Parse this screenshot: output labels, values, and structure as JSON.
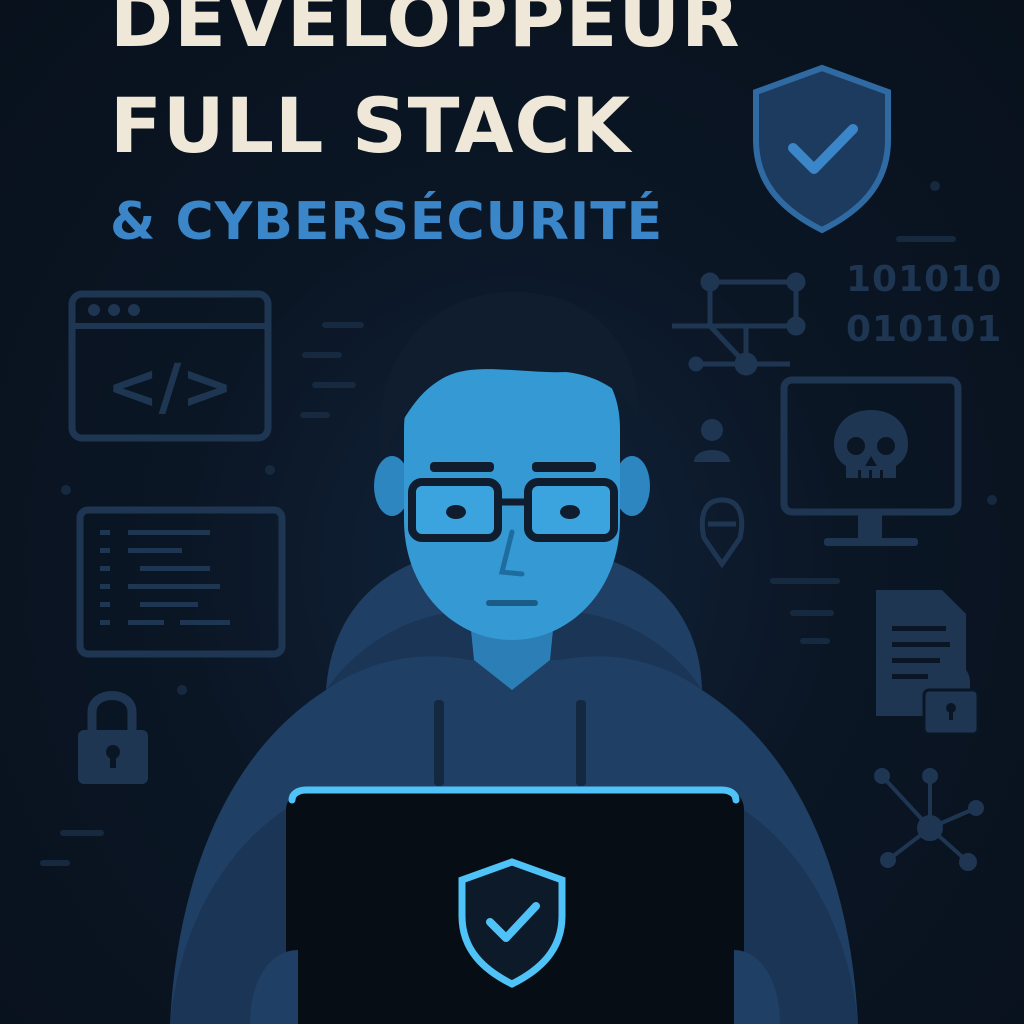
{
  "title": {
    "line1": "DÉVELOPPEUR",
    "line2": "FULL STACK"
  },
  "subtitle": "& CYBERSÉCURITÉ",
  "binary": {
    "line1": "101010",
    "line2": "010101"
  },
  "code_symbol": "</>",
  "colors": {
    "background": "#0b1421",
    "title": "#efe8d8",
    "accent": "#3a86c8",
    "icon_dim": "#1e3652",
    "glow": "#4fc3f7"
  },
  "icons": [
    "shield-check-icon",
    "code-window-icon",
    "code-editor-icon",
    "padlock-icon",
    "network-icon",
    "skull-monitor-icon",
    "locked-document-icon",
    "user-icon",
    "hooded-figure-icon",
    "laptop-shield-icon"
  ]
}
